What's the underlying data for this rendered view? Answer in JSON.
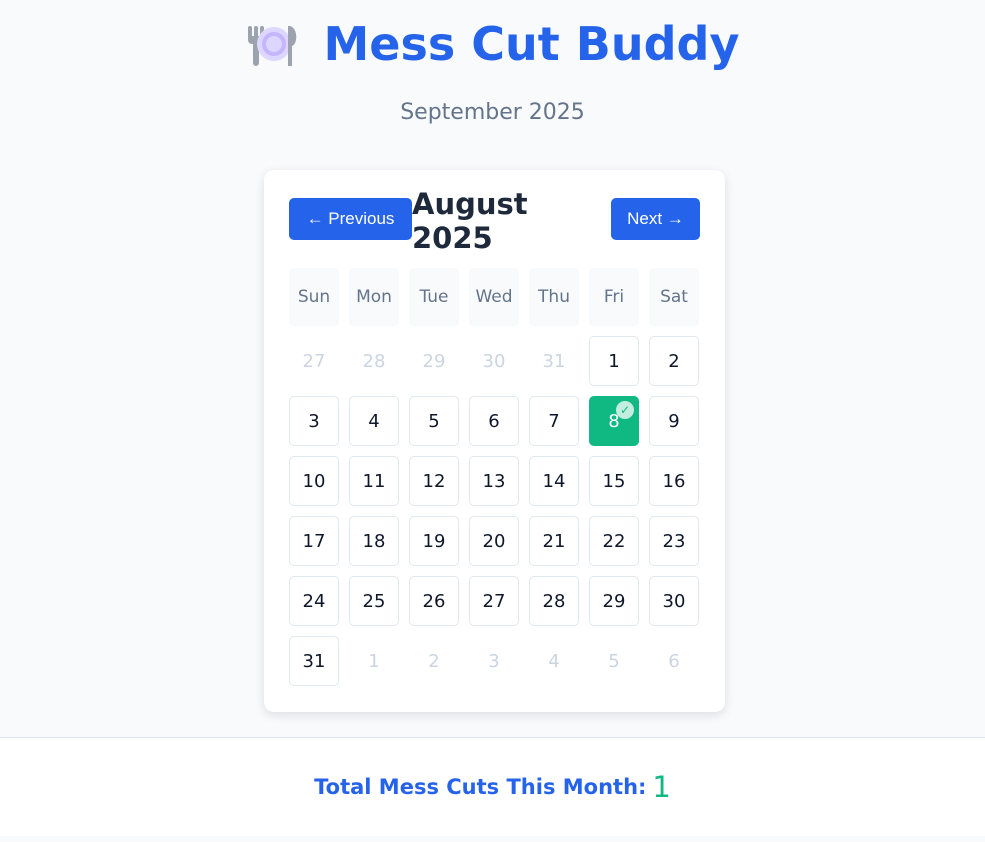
{
  "app": {
    "title": "Mess Cut Buddy",
    "logo_icon": "plate-cutlery-icon",
    "current_month": "September 2025"
  },
  "calendar": {
    "prev_label": "← Previous",
    "next_label": "Next →",
    "month_label": "August 2025",
    "weekdays": [
      "Sun",
      "Mon",
      "Tue",
      "Wed",
      "Thu",
      "Fri",
      "Sat"
    ],
    "cells": [
      {
        "label": "27",
        "in_month": false,
        "cut": false
      },
      {
        "label": "28",
        "in_month": false,
        "cut": false
      },
      {
        "label": "29",
        "in_month": false,
        "cut": false
      },
      {
        "label": "30",
        "in_month": false,
        "cut": false
      },
      {
        "label": "31",
        "in_month": false,
        "cut": false
      },
      {
        "label": "1",
        "in_month": true,
        "cut": false
      },
      {
        "label": "2",
        "in_month": true,
        "cut": false
      },
      {
        "label": "3",
        "in_month": true,
        "cut": false
      },
      {
        "label": "4",
        "in_month": true,
        "cut": false
      },
      {
        "label": "5",
        "in_month": true,
        "cut": false
      },
      {
        "label": "6",
        "in_month": true,
        "cut": false
      },
      {
        "label": "7",
        "in_month": true,
        "cut": false
      },
      {
        "label": "8",
        "in_month": true,
        "cut": true
      },
      {
        "label": "9",
        "in_month": true,
        "cut": false
      },
      {
        "label": "10",
        "in_month": true,
        "cut": false
      },
      {
        "label": "11",
        "in_month": true,
        "cut": false
      },
      {
        "label": "12",
        "in_month": true,
        "cut": false
      },
      {
        "label": "13",
        "in_month": true,
        "cut": false
      },
      {
        "label": "14",
        "in_month": true,
        "cut": false
      },
      {
        "label": "15",
        "in_month": true,
        "cut": false
      },
      {
        "label": "16",
        "in_month": true,
        "cut": false
      },
      {
        "label": "17",
        "in_month": true,
        "cut": false
      },
      {
        "label": "18",
        "in_month": true,
        "cut": false
      },
      {
        "label": "19",
        "in_month": true,
        "cut": false
      },
      {
        "label": "20",
        "in_month": true,
        "cut": false
      },
      {
        "label": "21",
        "in_month": true,
        "cut": false
      },
      {
        "label": "22",
        "in_month": true,
        "cut": false
      },
      {
        "label": "23",
        "in_month": true,
        "cut": false
      },
      {
        "label": "24",
        "in_month": true,
        "cut": false
      },
      {
        "label": "25",
        "in_month": true,
        "cut": false
      },
      {
        "label": "26",
        "in_month": true,
        "cut": false
      },
      {
        "label": "27",
        "in_month": true,
        "cut": false
      },
      {
        "label": "28",
        "in_month": true,
        "cut": false
      },
      {
        "label": "29",
        "in_month": true,
        "cut": false
      },
      {
        "label": "30",
        "in_month": true,
        "cut": false
      },
      {
        "label": "31",
        "in_month": true,
        "cut": false
      },
      {
        "label": "1",
        "in_month": false,
        "cut": false
      },
      {
        "label": "2",
        "in_month": false,
        "cut": false
      },
      {
        "label": "3",
        "in_month": false,
        "cut": false
      },
      {
        "label": "4",
        "in_month": false,
        "cut": false
      },
      {
        "label": "5",
        "in_month": false,
        "cut": false
      },
      {
        "label": "6",
        "in_month": false,
        "cut": false
      }
    ],
    "cut_mark": "✓"
  },
  "summary": {
    "label": "Total Mess Cuts This Month:",
    "value": "1"
  },
  "colors": {
    "primary": "#2563eb",
    "cut": "#10b981",
    "muted_text": "#64748b",
    "page_bg": "#f8fafc"
  }
}
